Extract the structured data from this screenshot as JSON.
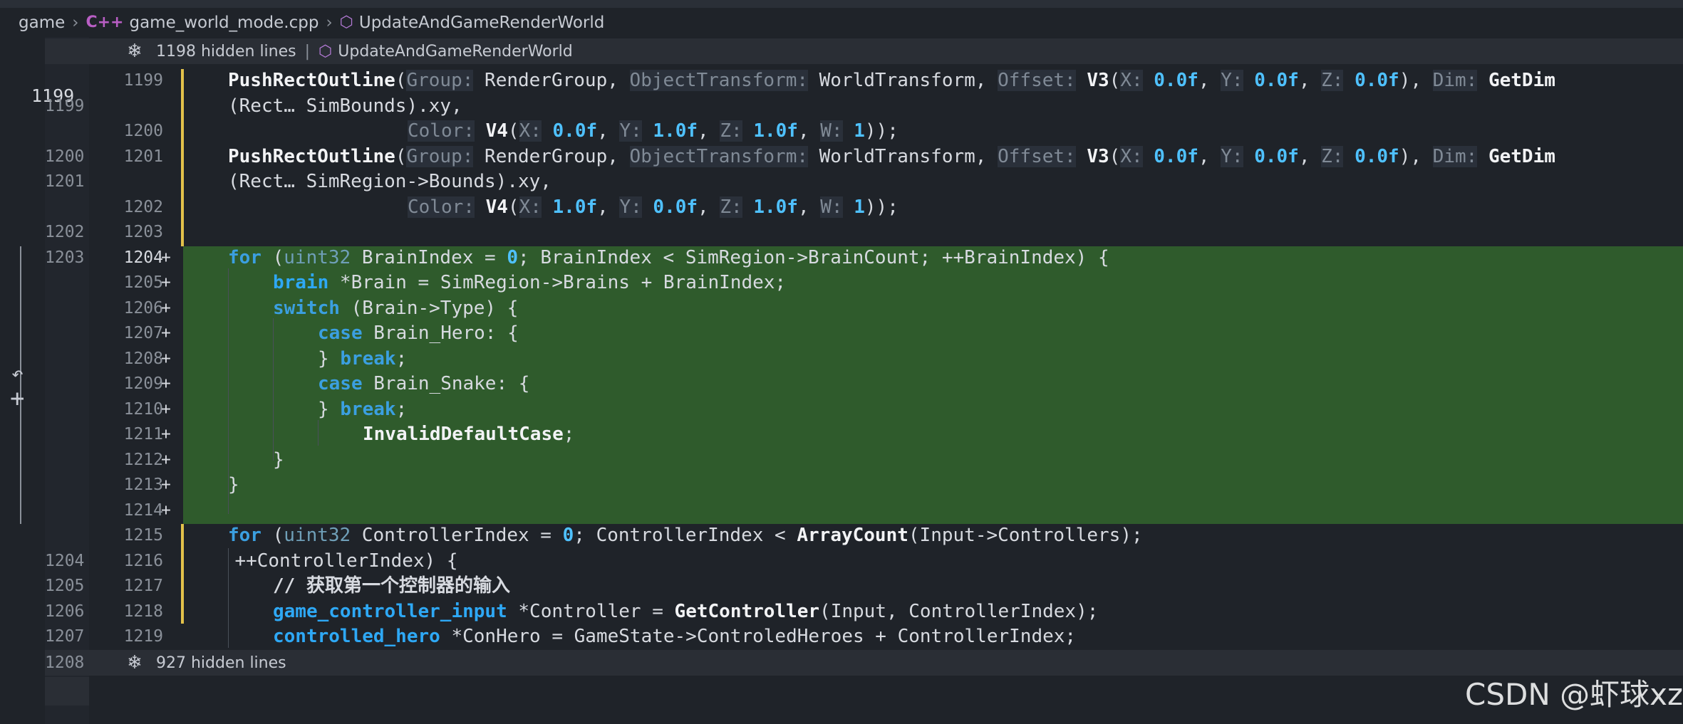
{
  "breadcrumb": {
    "folder": "game",
    "file_icon": "cpp-icon",
    "file": "game_world_mode.cpp",
    "symbol_icon": "cube-icon",
    "symbol": "UpdateAndGameRenderWorld"
  },
  "hidden_top": {
    "label": "1198 hidden lines",
    "symbol": "UpdateAndGameRenderWorld"
  },
  "hidden_bottom": {
    "label": "927 hidden lines",
    "old_line": "1208"
  },
  "cursor_line": "1199",
  "rows": [
    {
      "old": "",
      "new": "1199",
      "code": "PushRectOutline(Group: RenderGroup, ObjectTransform: WorldTransform, Offset: V3(X: 0.0f, Y: 0.0f, Z: 0.0f), Dim: GetDim"
    },
    {
      "old": "1199",
      "new": "",
      "code": "(Rect… SimBounds).xy,"
    },
    {
      "old": "",
      "new": "1200",
      "code": "Color: V4(X: 0.0f, Y: 1.0f, Z: 1.0f, W: 1));"
    },
    {
      "old": "1200",
      "new": "1201",
      "code": "PushRectOutline(Group: RenderGroup, ObjectTransform: WorldTransform, Offset: V3(X: 0.0f, Y: 0.0f, Z: 0.0f), Dim: GetDim"
    },
    {
      "old": "1201",
      "new": "",
      "code": "(Rect… SimRegion->Bounds).xy,"
    },
    {
      "old": "",
      "new": "1202",
      "code": "Color: V4(X: 1.0f, Y: 0.0f, Z: 1.0f, W: 1));"
    },
    {
      "old": "1202",
      "new": "1203",
      "code": ""
    },
    {
      "old": "1203",
      "new": "1204",
      "added": true,
      "code": "for (uint32 BrainIndex = 0; BrainIndex < SimRegion->BrainCount; ++BrainIndex) {"
    },
    {
      "old": "",
      "new": "1205",
      "added": true,
      "code": "brain *Brain = SimRegion->Brains + BrainIndex;"
    },
    {
      "old": "",
      "new": "1206",
      "added": true,
      "code": "switch (Brain->Type) {"
    },
    {
      "old": "",
      "new": "1207",
      "added": true,
      "code": "case Brain_Hero: {"
    },
    {
      "old": "",
      "new": "1208",
      "added": true,
      "code": "} break;"
    },
    {
      "old": "",
      "new": "1209",
      "added": true,
      "code": "case Brain_Snake: {"
    },
    {
      "old": "",
      "new": "1210",
      "added": true,
      "code": "} break;"
    },
    {
      "old": "",
      "new": "1211",
      "added": true,
      "code": "InvalidDefaultCase;"
    },
    {
      "old": "",
      "new": "1212",
      "added": true,
      "code": "}"
    },
    {
      "old": "",
      "new": "1213",
      "added": true,
      "code": "}"
    },
    {
      "old": "",
      "new": "1214",
      "added": true,
      "code": ""
    },
    {
      "old": "",
      "new": "1215",
      "code": "for (uint32 ControllerIndex = 0; ControllerIndex < ArrayCount(Input->Controllers);"
    },
    {
      "old": "1204",
      "new": "1216",
      "code": "++ControllerIndex) {"
    },
    {
      "old": "1205",
      "new": "1217",
      "code": "// 获取第一个控制器的输入"
    },
    {
      "old": "1206",
      "new": "1218",
      "code": "game_controller_input *Controller = GetController(Input, ControllerIndex);"
    },
    {
      "old": "1207",
      "new": "1219",
      "code": "controlled_hero *ConHero = GameState->ControledHeroes + ControllerIndex;"
    }
  ],
  "plus_marker": "+",
  "watermark": "CSDN @虾球xz",
  "colors": {
    "added_bg": "#2f5b2c",
    "modified_bar": "#e2c14a",
    "editor_bg": "#1f2329"
  }
}
